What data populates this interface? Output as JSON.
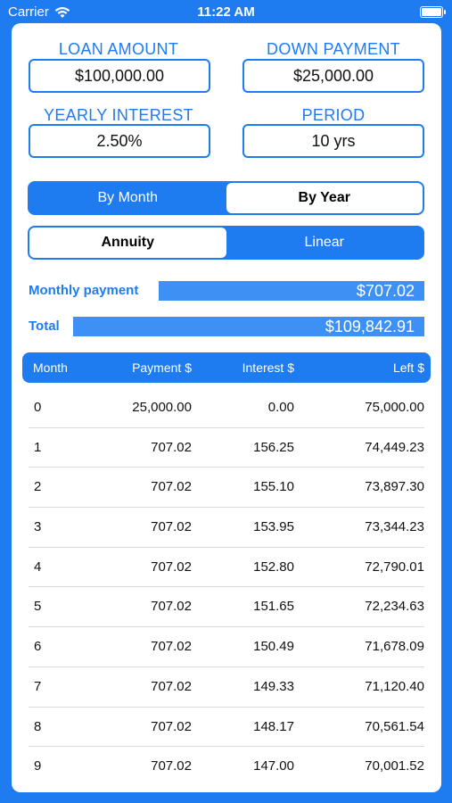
{
  "status": {
    "carrier": "Carrier",
    "time": "11:22 AM"
  },
  "inputs": {
    "loan_amount": {
      "label": "LOAN AMOUNT",
      "value": "$100,000.00"
    },
    "down_payment": {
      "label": "DOWN PAYMENT",
      "value": "$25,000.00"
    },
    "yearly_interest": {
      "label": "YEARLY INTEREST",
      "value": "2.50%"
    },
    "period": {
      "label": "PERIOD",
      "value": "10 yrs"
    }
  },
  "view_toggle": {
    "by_month": "By Month",
    "by_year": "By Year",
    "selected": "by_year"
  },
  "type_toggle": {
    "annuity": "Annuity",
    "linear": "Linear",
    "selected": "annuity"
  },
  "summary": {
    "monthly_label": "Monthly payment",
    "monthly_value": "$707.02",
    "total_label": "Total",
    "total_value": "$109,842.91"
  },
  "table": {
    "headers": {
      "month": "Month",
      "payment": "Payment $",
      "interest": "Interest $",
      "left": "Left $"
    },
    "rows": [
      {
        "month": "0",
        "payment": "25,000.00",
        "interest": "0.00",
        "left": "75,000.00"
      },
      {
        "month": "1",
        "payment": "707.02",
        "interest": "156.25",
        "left": "74,449.23"
      },
      {
        "month": "2",
        "payment": "707.02",
        "interest": "155.10",
        "left": "73,897.30"
      },
      {
        "month": "3",
        "payment": "707.02",
        "interest": "153.95",
        "left": "73,344.23"
      },
      {
        "month": "4",
        "payment": "707.02",
        "interest": "152.80",
        "left": "72,790.01"
      },
      {
        "month": "5",
        "payment": "707.02",
        "interest": "151.65",
        "left": "72,234.63"
      },
      {
        "month": "6",
        "payment": "707.02",
        "interest": "150.49",
        "left": "71,678.09"
      },
      {
        "month": "7",
        "payment": "707.02",
        "interest": "149.33",
        "left": "71,120.40"
      },
      {
        "month": "8",
        "payment": "707.02",
        "interest": "148.17",
        "left": "70,561.54"
      },
      {
        "month": "9",
        "payment": "707.02",
        "interest": "147.00",
        "left": "70,001.52"
      }
    ]
  },
  "colors": {
    "accent": "#1e7bf0",
    "bar": "#3d91f5"
  }
}
